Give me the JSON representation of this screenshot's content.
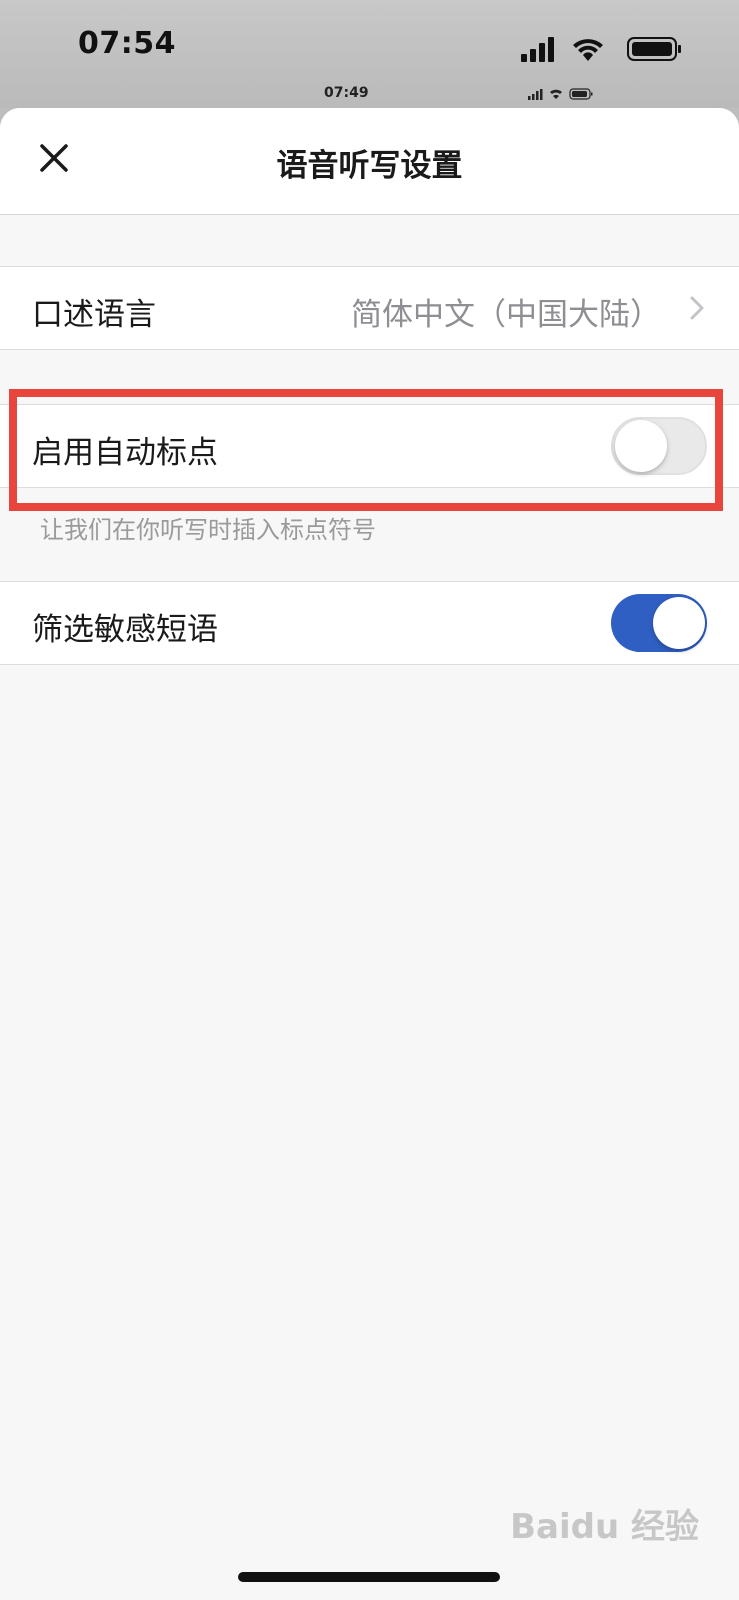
{
  "status_bar": {
    "time": "07:54"
  },
  "inner_status_bar": {
    "time": "07:49"
  },
  "header": {
    "title": "语音听写设置"
  },
  "settings": {
    "dictation_language": {
      "label": "口述语言",
      "value": "简体中文（中国大陆）"
    },
    "auto_punctuation": {
      "label": "启用自动标点",
      "enabled": false,
      "hint": "让我们在你听写时插入标点符号"
    },
    "filter_sensitive": {
      "label": "筛选敏感短语",
      "enabled": true
    }
  },
  "watermark": {
    "text": "Baidu 经验"
  },
  "colors": {
    "toggle_on": "#2f5fc2",
    "highlight": "#e8453c",
    "sheet_background": "#f7f7f7"
  }
}
